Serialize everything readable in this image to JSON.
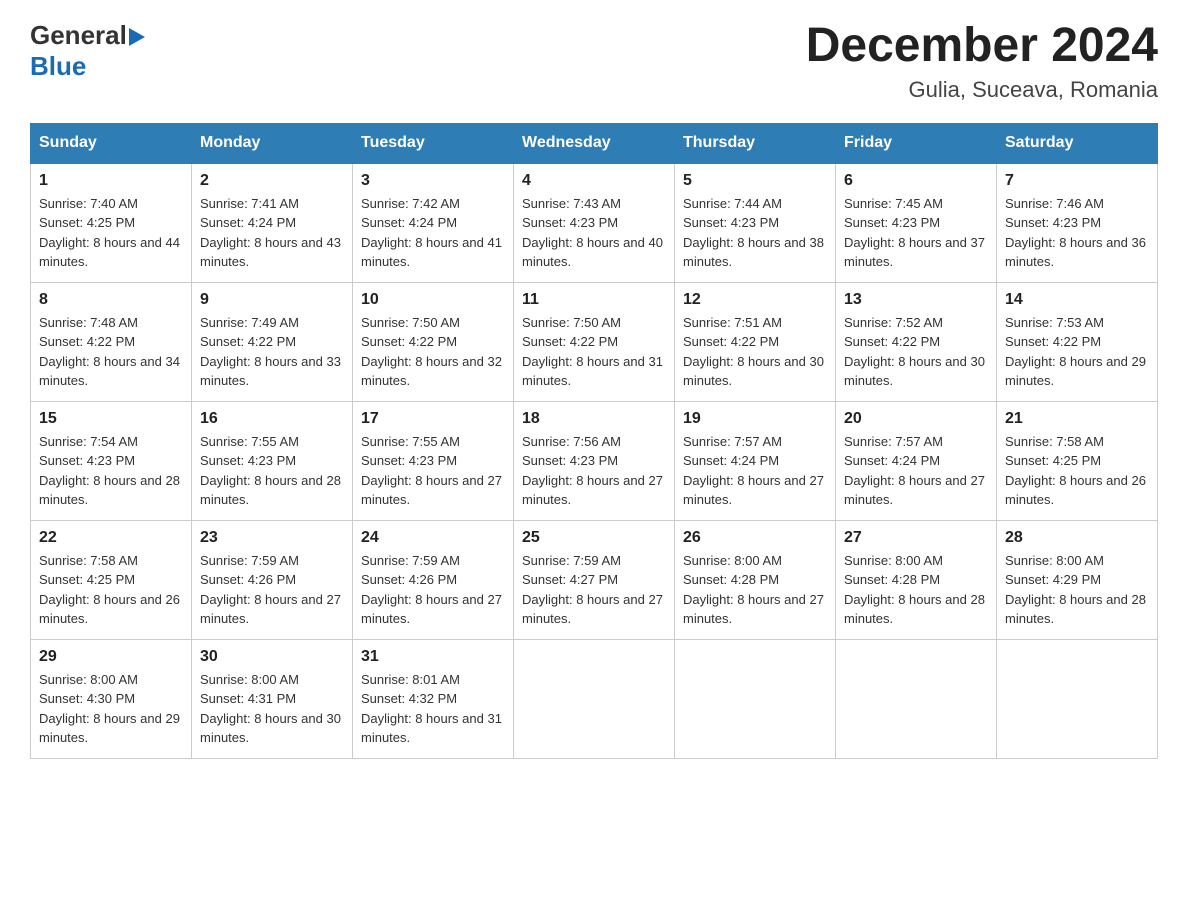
{
  "header": {
    "title": "December 2024",
    "subtitle": "Gulia, Suceava, Romania",
    "logo_general": "General",
    "logo_blue": "Blue"
  },
  "calendar": {
    "days_of_week": [
      "Sunday",
      "Monday",
      "Tuesday",
      "Wednesday",
      "Thursday",
      "Friday",
      "Saturday"
    ],
    "weeks": [
      [
        {
          "day": "1",
          "sunrise": "7:40 AM",
          "sunset": "4:25 PM",
          "daylight": "8 hours and 44 minutes."
        },
        {
          "day": "2",
          "sunrise": "7:41 AM",
          "sunset": "4:24 PM",
          "daylight": "8 hours and 43 minutes."
        },
        {
          "day": "3",
          "sunrise": "7:42 AM",
          "sunset": "4:24 PM",
          "daylight": "8 hours and 41 minutes."
        },
        {
          "day": "4",
          "sunrise": "7:43 AM",
          "sunset": "4:23 PM",
          "daylight": "8 hours and 40 minutes."
        },
        {
          "day": "5",
          "sunrise": "7:44 AM",
          "sunset": "4:23 PM",
          "daylight": "8 hours and 38 minutes."
        },
        {
          "day": "6",
          "sunrise": "7:45 AM",
          "sunset": "4:23 PM",
          "daylight": "8 hours and 37 minutes."
        },
        {
          "day": "7",
          "sunrise": "7:46 AM",
          "sunset": "4:23 PM",
          "daylight": "8 hours and 36 minutes."
        }
      ],
      [
        {
          "day": "8",
          "sunrise": "7:48 AM",
          "sunset": "4:22 PM",
          "daylight": "8 hours and 34 minutes."
        },
        {
          "day": "9",
          "sunrise": "7:49 AM",
          "sunset": "4:22 PM",
          "daylight": "8 hours and 33 minutes."
        },
        {
          "day": "10",
          "sunrise": "7:50 AM",
          "sunset": "4:22 PM",
          "daylight": "8 hours and 32 minutes."
        },
        {
          "day": "11",
          "sunrise": "7:50 AM",
          "sunset": "4:22 PM",
          "daylight": "8 hours and 31 minutes."
        },
        {
          "day": "12",
          "sunrise": "7:51 AM",
          "sunset": "4:22 PM",
          "daylight": "8 hours and 30 minutes."
        },
        {
          "day": "13",
          "sunrise": "7:52 AM",
          "sunset": "4:22 PM",
          "daylight": "8 hours and 30 minutes."
        },
        {
          "day": "14",
          "sunrise": "7:53 AM",
          "sunset": "4:22 PM",
          "daylight": "8 hours and 29 minutes."
        }
      ],
      [
        {
          "day": "15",
          "sunrise": "7:54 AM",
          "sunset": "4:23 PM",
          "daylight": "8 hours and 28 minutes."
        },
        {
          "day": "16",
          "sunrise": "7:55 AM",
          "sunset": "4:23 PM",
          "daylight": "8 hours and 28 minutes."
        },
        {
          "day": "17",
          "sunrise": "7:55 AM",
          "sunset": "4:23 PM",
          "daylight": "8 hours and 27 minutes."
        },
        {
          "day": "18",
          "sunrise": "7:56 AM",
          "sunset": "4:23 PM",
          "daylight": "8 hours and 27 minutes."
        },
        {
          "day": "19",
          "sunrise": "7:57 AM",
          "sunset": "4:24 PM",
          "daylight": "8 hours and 27 minutes."
        },
        {
          "day": "20",
          "sunrise": "7:57 AM",
          "sunset": "4:24 PM",
          "daylight": "8 hours and 27 minutes."
        },
        {
          "day": "21",
          "sunrise": "7:58 AM",
          "sunset": "4:25 PM",
          "daylight": "8 hours and 26 minutes."
        }
      ],
      [
        {
          "day": "22",
          "sunrise": "7:58 AM",
          "sunset": "4:25 PM",
          "daylight": "8 hours and 26 minutes."
        },
        {
          "day": "23",
          "sunrise": "7:59 AM",
          "sunset": "4:26 PM",
          "daylight": "8 hours and 27 minutes."
        },
        {
          "day": "24",
          "sunrise": "7:59 AM",
          "sunset": "4:26 PM",
          "daylight": "8 hours and 27 minutes."
        },
        {
          "day": "25",
          "sunrise": "7:59 AM",
          "sunset": "4:27 PM",
          "daylight": "8 hours and 27 minutes."
        },
        {
          "day": "26",
          "sunrise": "8:00 AM",
          "sunset": "4:28 PM",
          "daylight": "8 hours and 27 minutes."
        },
        {
          "day": "27",
          "sunrise": "8:00 AM",
          "sunset": "4:28 PM",
          "daylight": "8 hours and 28 minutes."
        },
        {
          "day": "28",
          "sunrise": "8:00 AM",
          "sunset": "4:29 PM",
          "daylight": "8 hours and 28 minutes."
        }
      ],
      [
        {
          "day": "29",
          "sunrise": "8:00 AM",
          "sunset": "4:30 PM",
          "daylight": "8 hours and 29 minutes."
        },
        {
          "day": "30",
          "sunrise": "8:00 AM",
          "sunset": "4:31 PM",
          "daylight": "8 hours and 30 minutes."
        },
        {
          "day": "31",
          "sunrise": "8:01 AM",
          "sunset": "4:32 PM",
          "daylight": "8 hours and 31 minutes."
        },
        null,
        null,
        null,
        null
      ]
    ]
  }
}
